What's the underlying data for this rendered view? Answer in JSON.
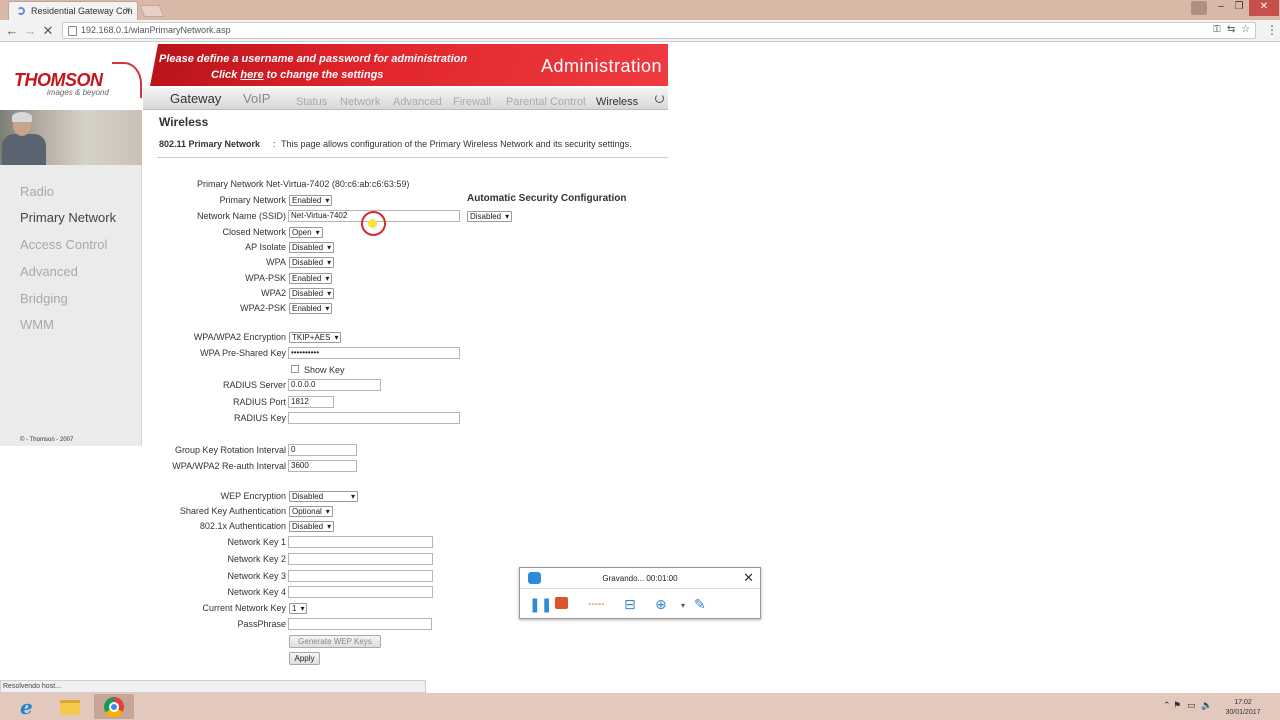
{
  "browser": {
    "tab_title": "Residential Gateway Con",
    "tab_close": "×",
    "url": "192.168.0.1/wlanPrimaryNetwork.asp",
    "back": "←",
    "forward": "→",
    "reload": "✕",
    "status_text": "Resolvendo host..."
  },
  "brand": {
    "logo_text": "THOMSON",
    "tagline": "images & beyond"
  },
  "banner": {
    "line1": "Please define a username and password for administration",
    "line2_prefix": "Click ",
    "line2_link": "here",
    "line2_suffix": " to change the settings",
    "section": "Administration"
  },
  "topnav": {
    "gateway": "Gateway",
    "voip": "VoIP",
    "items": [
      "Status",
      "Network",
      "Advanced",
      "Firewall",
      "Parental Control",
      "Wireless"
    ]
  },
  "sidebar": {
    "items": [
      "Radio",
      "Primary Network",
      "Access Control",
      "Advanced",
      "Bridging",
      "WMM"
    ],
    "copyright": "© - Thomson - 2007"
  },
  "page": {
    "title": "Wireless",
    "subtitle": "802.11 Primary Network",
    "separator": ":",
    "description": "This page allows configuration of the Primary Wireless Network and its security settings."
  },
  "form": {
    "network_info": "Primary Network Net-Virtua-7402 (80:c6:ab:c6:63:59)",
    "auto_security_title": "Automatic Security Configuration",
    "auto_security_value": "Disabled",
    "primary_network": {
      "label": "Primary Network",
      "value": "Enabled"
    },
    "ssid": {
      "label": "Network Name (SSID)",
      "value": "Net-Virtua-7402"
    },
    "closed_network": {
      "label": "Closed Network",
      "value": "Open"
    },
    "ap_isolate": {
      "label": "AP Isolate",
      "value": "Disabled"
    },
    "wpa": {
      "label": "WPA",
      "value": "Disabled"
    },
    "wpa_psk": {
      "label": "WPA-PSK",
      "value": "Enabled"
    },
    "wpa2": {
      "label": "WPA2",
      "value": "Disabled"
    },
    "wpa2_psk": {
      "label": "WPA2-PSK",
      "value": "Enabled"
    },
    "encryption": {
      "label": "WPA/WPA2 Encryption",
      "value": "TKIP+AES"
    },
    "psk": {
      "label": "WPA Pre-Shared Key",
      "value": "••••••••••"
    },
    "show_key": "Show Key",
    "radius_server": {
      "label": "RADIUS Server",
      "value": "0.0.0.0"
    },
    "radius_port": {
      "label": "RADIUS Port",
      "value": "1812"
    },
    "radius_key": {
      "label": "RADIUS Key",
      "value": ""
    },
    "group_key_interval": {
      "label": "Group Key Rotation Interval",
      "value": "0"
    },
    "reauth_interval": {
      "label": "WPA/WPA2 Re-auth Interval",
      "value": "3600"
    },
    "wep_encryption": {
      "label": "WEP Encryption",
      "value": "Disabled"
    },
    "shared_key_auth": {
      "label": "Shared Key Authentication",
      "value": "Optional"
    },
    "dot1x_auth": {
      "label": "802.1x Authentication",
      "value": "Disabled"
    },
    "network_key_1": {
      "label": "Network Key 1",
      "value": ""
    },
    "network_key_2": {
      "label": "Network Key 2",
      "value": ""
    },
    "network_key_3": {
      "label": "Network Key 3",
      "value": ""
    },
    "network_key_4": {
      "label": "Network Key 4",
      "value": ""
    },
    "current_network_key": {
      "label": "Current Network Key",
      "value": "1"
    },
    "passphrase": {
      "label": "PassPhrase",
      "value": ""
    },
    "generate_wep_keys": "Generate WEP Keys",
    "apply": "Apply"
  },
  "recorder": {
    "title": "Gravando... 00:01:00",
    "close": "✕"
  },
  "taskbar": {
    "time": "17:02",
    "date": "30/01/2017"
  },
  "colors": {
    "brand_red": "#c4161c",
    "taskbar": "#e3c9bd",
    "sidebar_bg": "#ebebeb"
  }
}
